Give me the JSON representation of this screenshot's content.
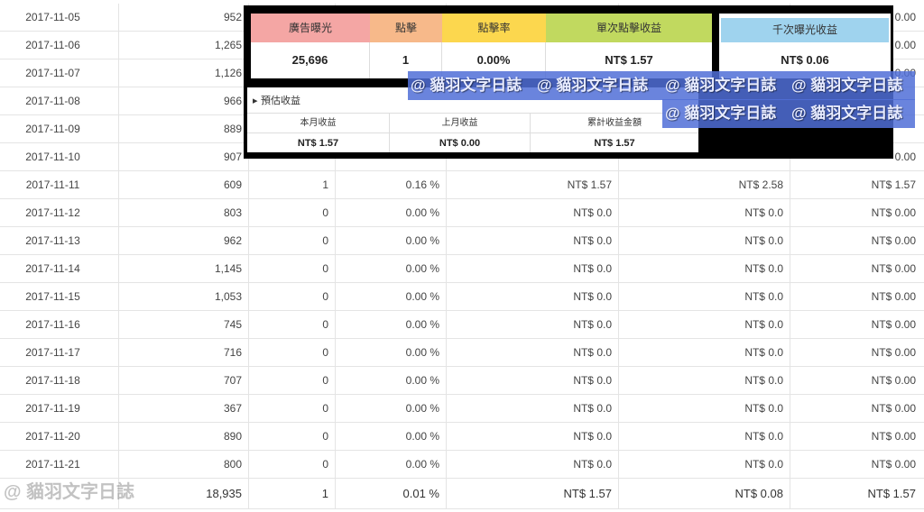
{
  "table": {
    "rows": [
      {
        "date": "2017-11-05",
        "impressions": "952",
        "clicks": "",
        "ctr": "",
        "cpc": "",
        "cpm": "",
        "revenue": ""
      },
      {
        "date": "2017-11-06",
        "impressions": "1,265",
        "clicks": "",
        "ctr": "",
        "cpc": "",
        "cpm": "",
        "revenue": ""
      },
      {
        "date": "2017-11-07",
        "impressions": "1,126",
        "clicks": "",
        "ctr": "",
        "cpc": "",
        "cpm": "",
        "revenue": ""
      },
      {
        "date": "2017-11-08",
        "impressions": "966",
        "clicks": "",
        "ctr": "",
        "cpc": "",
        "cpm": "",
        "revenue": ""
      },
      {
        "date": "2017-11-09",
        "impressions": "889",
        "clicks": "",
        "ctr": "",
        "cpc": "",
        "cpm": "",
        "revenue": ""
      },
      {
        "date": "2017-11-10",
        "impressions": "907",
        "clicks": "",
        "ctr": "",
        "cpc": "",
        "cpm": "",
        "revenue": ""
      },
      {
        "date": "2017-11-11",
        "impressions": "609",
        "clicks": "1",
        "ctr": "0.16 %",
        "cpc": "NT$ 1.57",
        "cpm": "NT$ 2.58",
        "revenue": "NT$ 1.57"
      },
      {
        "date": "2017-11-12",
        "impressions": "803",
        "clicks": "0",
        "ctr": "0.00 %",
        "cpc": "NT$ 0.0",
        "cpm": "NT$ 0.0",
        "revenue": "NT$ 0.00"
      },
      {
        "date": "2017-11-13",
        "impressions": "962",
        "clicks": "0",
        "ctr": "0.00 %",
        "cpc": "NT$ 0.0",
        "cpm": "NT$ 0.0",
        "revenue": "NT$ 0.00"
      },
      {
        "date": "2017-11-14",
        "impressions": "1,145",
        "clicks": "0",
        "ctr": "0.00 %",
        "cpc": "NT$ 0.0",
        "cpm": "NT$ 0.0",
        "revenue": "NT$ 0.00"
      },
      {
        "date": "2017-11-15",
        "impressions": "1,053",
        "clicks": "0",
        "ctr": "0.00 %",
        "cpc": "NT$ 0.0",
        "cpm": "NT$ 0.0",
        "revenue": "NT$ 0.00"
      },
      {
        "date": "2017-11-16",
        "impressions": "745",
        "clicks": "0",
        "ctr": "0.00 %",
        "cpc": "NT$ 0.0",
        "cpm": "NT$ 0.0",
        "revenue": "NT$ 0.00"
      },
      {
        "date": "2017-11-17",
        "impressions": "716",
        "clicks": "0",
        "ctr": "0.00 %",
        "cpc": "NT$ 0.0",
        "cpm": "NT$ 0.0",
        "revenue": "NT$ 0.00"
      },
      {
        "date": "2017-11-18",
        "impressions": "707",
        "clicks": "0",
        "ctr": "0.00 %",
        "cpc": "NT$ 0.0",
        "cpm": "NT$ 0.0",
        "revenue": "NT$ 0.00"
      },
      {
        "date": "2017-11-19",
        "impressions": "367",
        "clicks": "0",
        "ctr": "0.00 %",
        "cpc": "NT$ 0.0",
        "cpm": "NT$ 0.0",
        "revenue": "NT$ 0.00"
      },
      {
        "date": "2017-11-20",
        "impressions": "890",
        "clicks": "0",
        "ctr": "0.00 %",
        "cpc": "NT$ 0.0",
        "cpm": "NT$ 0.0",
        "revenue": "NT$ 0.00"
      },
      {
        "date": "2017-11-21",
        "impressions": "800",
        "clicks": "0",
        "ctr": "0.00 %",
        "cpc": "NT$ 0.0",
        "cpm": "NT$ 0.0",
        "revenue": "NT$ 0.00"
      }
    ],
    "total": {
      "date": "",
      "impressions": "18,935",
      "clicks": "1",
      "ctr": "0.01 %",
      "cpc": "NT$ 1.57",
      "cpm": "NT$ 0.08",
      "revenue": "NT$ 1.57"
    },
    "partial_values": {
      "row0_revenue": "0.00",
      "row1_revenue": "0.00",
      "row2_revenue": "0.00",
      "row5_revenue": "0.00"
    }
  },
  "summary": {
    "headers": [
      {
        "label": "廣告曝光",
        "color": "#f4a6a4"
      },
      {
        "label": "點擊",
        "color": "#f7b98a"
      },
      {
        "label": "點擊率",
        "color": "#fcd74e"
      },
      {
        "label": "單次點擊收益",
        "color": "#c1d95f"
      }
    ],
    "values": [
      "25,696",
      "1",
      "0.00%",
      "NT$ 1.57"
    ],
    "cpm_header": {
      "label": "千次曝光收益",
      "color": "#9fd3ee"
    },
    "cpm_value": "NT$ 0.06"
  },
  "estimate": {
    "title": "▸ 預估收益",
    "headers": [
      "本月收益",
      "上月收益",
      "累計收益金額"
    ],
    "values": [
      "NT$ 1.57",
      "NT$ 0.00",
      "NT$ 1.57"
    ]
  },
  "watermarks": {
    "text": "@ 貓羽文字日誌",
    "bottom": "@ 貓羽文字日誌"
  }
}
